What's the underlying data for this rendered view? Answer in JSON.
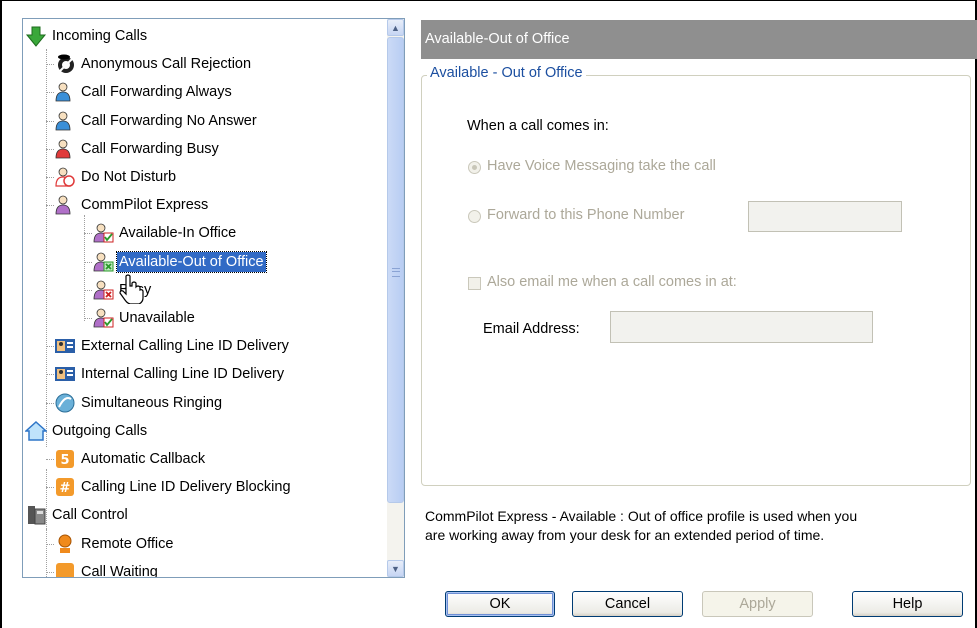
{
  "tree": {
    "items": [
      {
        "label": "Incoming Calls",
        "icon": "incoming-calls-arrow-icon",
        "level": 0
      },
      {
        "label": "Anonymous Call Rejection",
        "icon": "anonymous-call-rejection-icon",
        "level": 1
      },
      {
        "label": "Call Forwarding Always",
        "icon": "call-forwarding-always-icon",
        "level": 1
      },
      {
        "label": "Call Forwarding No Answer",
        "icon": "call-forwarding-no-answer-icon",
        "level": 1
      },
      {
        "label": "Call Forwarding Busy",
        "icon": "call-forwarding-busy-icon",
        "level": 1
      },
      {
        "label": "Do Not Disturb",
        "icon": "do-not-disturb-icon",
        "level": 1
      },
      {
        "label": "CommPilot Express",
        "icon": "commpilot-express-icon",
        "level": 1
      },
      {
        "label": "Available-In Office",
        "icon": "available-in-office-icon",
        "level": 2
      },
      {
        "label": "Available-Out of Office",
        "icon": "available-out-of-office-icon",
        "level": 2,
        "selected": true
      },
      {
        "label": "Busy",
        "icon": "busy-icon",
        "level": 2
      },
      {
        "label": "Unavailable",
        "icon": "unavailable-icon",
        "level": 2
      },
      {
        "label": "External Calling Line ID Delivery",
        "icon": "external-calling-line-id-icon",
        "level": 1
      },
      {
        "label": "Internal Calling Line ID Delivery",
        "icon": "internal-calling-line-id-icon",
        "level": 1
      },
      {
        "label": "Simultaneous Ringing",
        "icon": "simultaneous-ringing-icon",
        "level": 1
      },
      {
        "label": "Outgoing Calls",
        "icon": "outgoing-calls-house-icon",
        "level": 0
      },
      {
        "label": "Automatic Callback",
        "icon": "automatic-callback-icon",
        "level": 1
      },
      {
        "label": "Calling Line ID Delivery Blocking",
        "icon": "calling-line-id-blocking-icon",
        "level": 1
      },
      {
        "label": "Call Control",
        "icon": "call-control-phone-icon",
        "level": 0
      },
      {
        "label": "Remote Office",
        "icon": "remote-office-icon",
        "level": 1
      },
      {
        "label": "Call Waiting",
        "icon": "call-waiting-icon",
        "level": 1
      }
    ]
  },
  "panel": {
    "header": "Available-Out of Office",
    "group_title": "Available - Out of Office",
    "when_label": "When a call comes in:",
    "radio_voice": "Have Voice Messaging take the call",
    "radio_forward": "Forward to this Phone Number",
    "forward_number_value": "",
    "email_checkbox": "Also email me when a call comes in at:",
    "email_label": "Email Address:",
    "email_value": "",
    "description_line1": "CommPilot Express - Available : Out of office profile is used when you",
    "description_line2": "are working away from your desk for an extended period of time."
  },
  "buttons": {
    "ok": "OK",
    "cancel": "Cancel",
    "apply": "Apply",
    "help": "Help"
  },
  "colors": {
    "selection": "#316ac5",
    "header_bg": "#8f8f8f",
    "group_title": "#1c4fa0",
    "button_border": "#003c74"
  }
}
